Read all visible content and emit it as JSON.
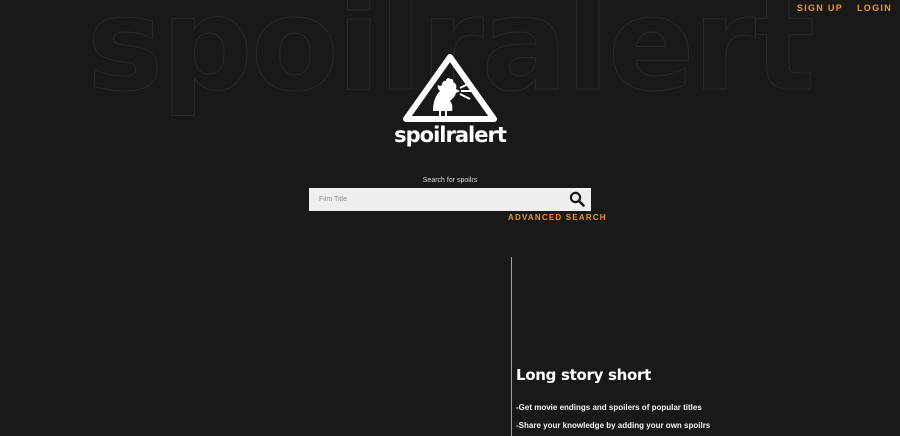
{
  "background_word": "spoilralert",
  "nav": {
    "signup": "SIGN UP",
    "login": "LOGIN"
  },
  "brand": {
    "name": "spoilralert",
    "logo_icon": "rooster-warning-triangle-icon"
  },
  "search": {
    "label": "Search for spoilrs",
    "placeholder": "Film Title",
    "value": "",
    "button_icon": "search-icon",
    "advanced_label": "ADVANCED SEARCH"
  },
  "info": {
    "title": "Long story short",
    "bullets": [
      "-Get movie endings and spoilers of popular titles",
      "-Share your knowledge by adding your own spoilrs"
    ]
  },
  "colors": {
    "background": "#1a1919",
    "accent": "#e8942f",
    "text": "#ffffff",
    "search_bg": "#f0efef"
  }
}
